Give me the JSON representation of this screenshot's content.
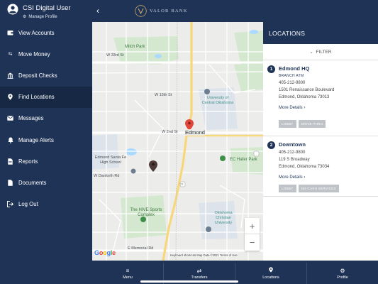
{
  "user": {
    "name": "CSI Digital User",
    "manage_label": "Manage Profile"
  },
  "sidebar": {
    "items": [
      {
        "label": "View Accounts",
        "icon": "wallet-icon"
      },
      {
        "label": "Move Money",
        "icon": "transfer-icon"
      },
      {
        "label": "Deposit Checks",
        "icon": "bank-icon"
      },
      {
        "label": "Find Locations",
        "icon": "location-pin-icon",
        "active": true
      },
      {
        "label": "Messages",
        "icon": "envelope-icon"
      },
      {
        "label": "Manage Alerts",
        "icon": "bell-icon"
      },
      {
        "label": "Reports",
        "icon": "document-icon"
      },
      {
        "label": "Documents",
        "icon": "file-icon"
      },
      {
        "label": "Log Out",
        "icon": "logout-icon"
      }
    ]
  },
  "header": {
    "brand": "VALOR BANK"
  },
  "map": {
    "labels": {
      "mitch_park": "Mitch Park",
      "edmond": "Edmond",
      "uco": "University of Central Oklahoma",
      "santa_fe": "Edmond Santa Fe High School",
      "hafer": "EC Hafer Park",
      "hive": "The HIVE Sports Complex",
      "oc": "Oklahoma Christian University",
      "st_2nd": "W 2nd St",
      "st_15th": "W 15th St",
      "st_danforth": "W Danforth Rd",
      "st_memorial": "E Memorial Rd",
      "st_33rd": "W 33rd St",
      "st_hwy77": "77"
    },
    "zoom_in": "+",
    "zoom_out": "−",
    "google": "Google",
    "attribution": "Keyboard shortcuts   Map Data ©2021   Terms of Use"
  },
  "panel": {
    "title": "LOCATIONS",
    "filter_label": "FILTER",
    "locations": [
      {
        "number": "1",
        "name": "Edmond HQ",
        "types": "BRANCH  ATM",
        "phone": "405-212-9800",
        "address1": "1501 Renaissance Boulevard",
        "address2": "Edmond, Oklahoma 73013",
        "more": "More Details",
        "tags": [
          "LOBBY",
          "DRIVE-THRU"
        ]
      },
      {
        "number": "2",
        "name": "Downtown",
        "types": "",
        "phone": "405-212-9800",
        "address1": "119 S Broadway",
        "address2": "Edmond, Oklahoma 73034",
        "more": "More Details",
        "tags": [
          "LOBBY",
          "NO CASH SERVICES"
        ]
      }
    ]
  },
  "tabs": [
    {
      "label": "Menu",
      "icon": "menu-icon"
    },
    {
      "label": "Transfers",
      "icon": "transfer-icon"
    },
    {
      "label": "Locations",
      "icon": "location-pin-icon"
    },
    {
      "label": "Profile",
      "icon": "gear-icon"
    }
  ],
  "colors": {
    "navy": "#1f3356",
    "navy_dark": "#172845",
    "tag_gray": "#bfc3c8",
    "pin_red": "#e0463a"
  }
}
